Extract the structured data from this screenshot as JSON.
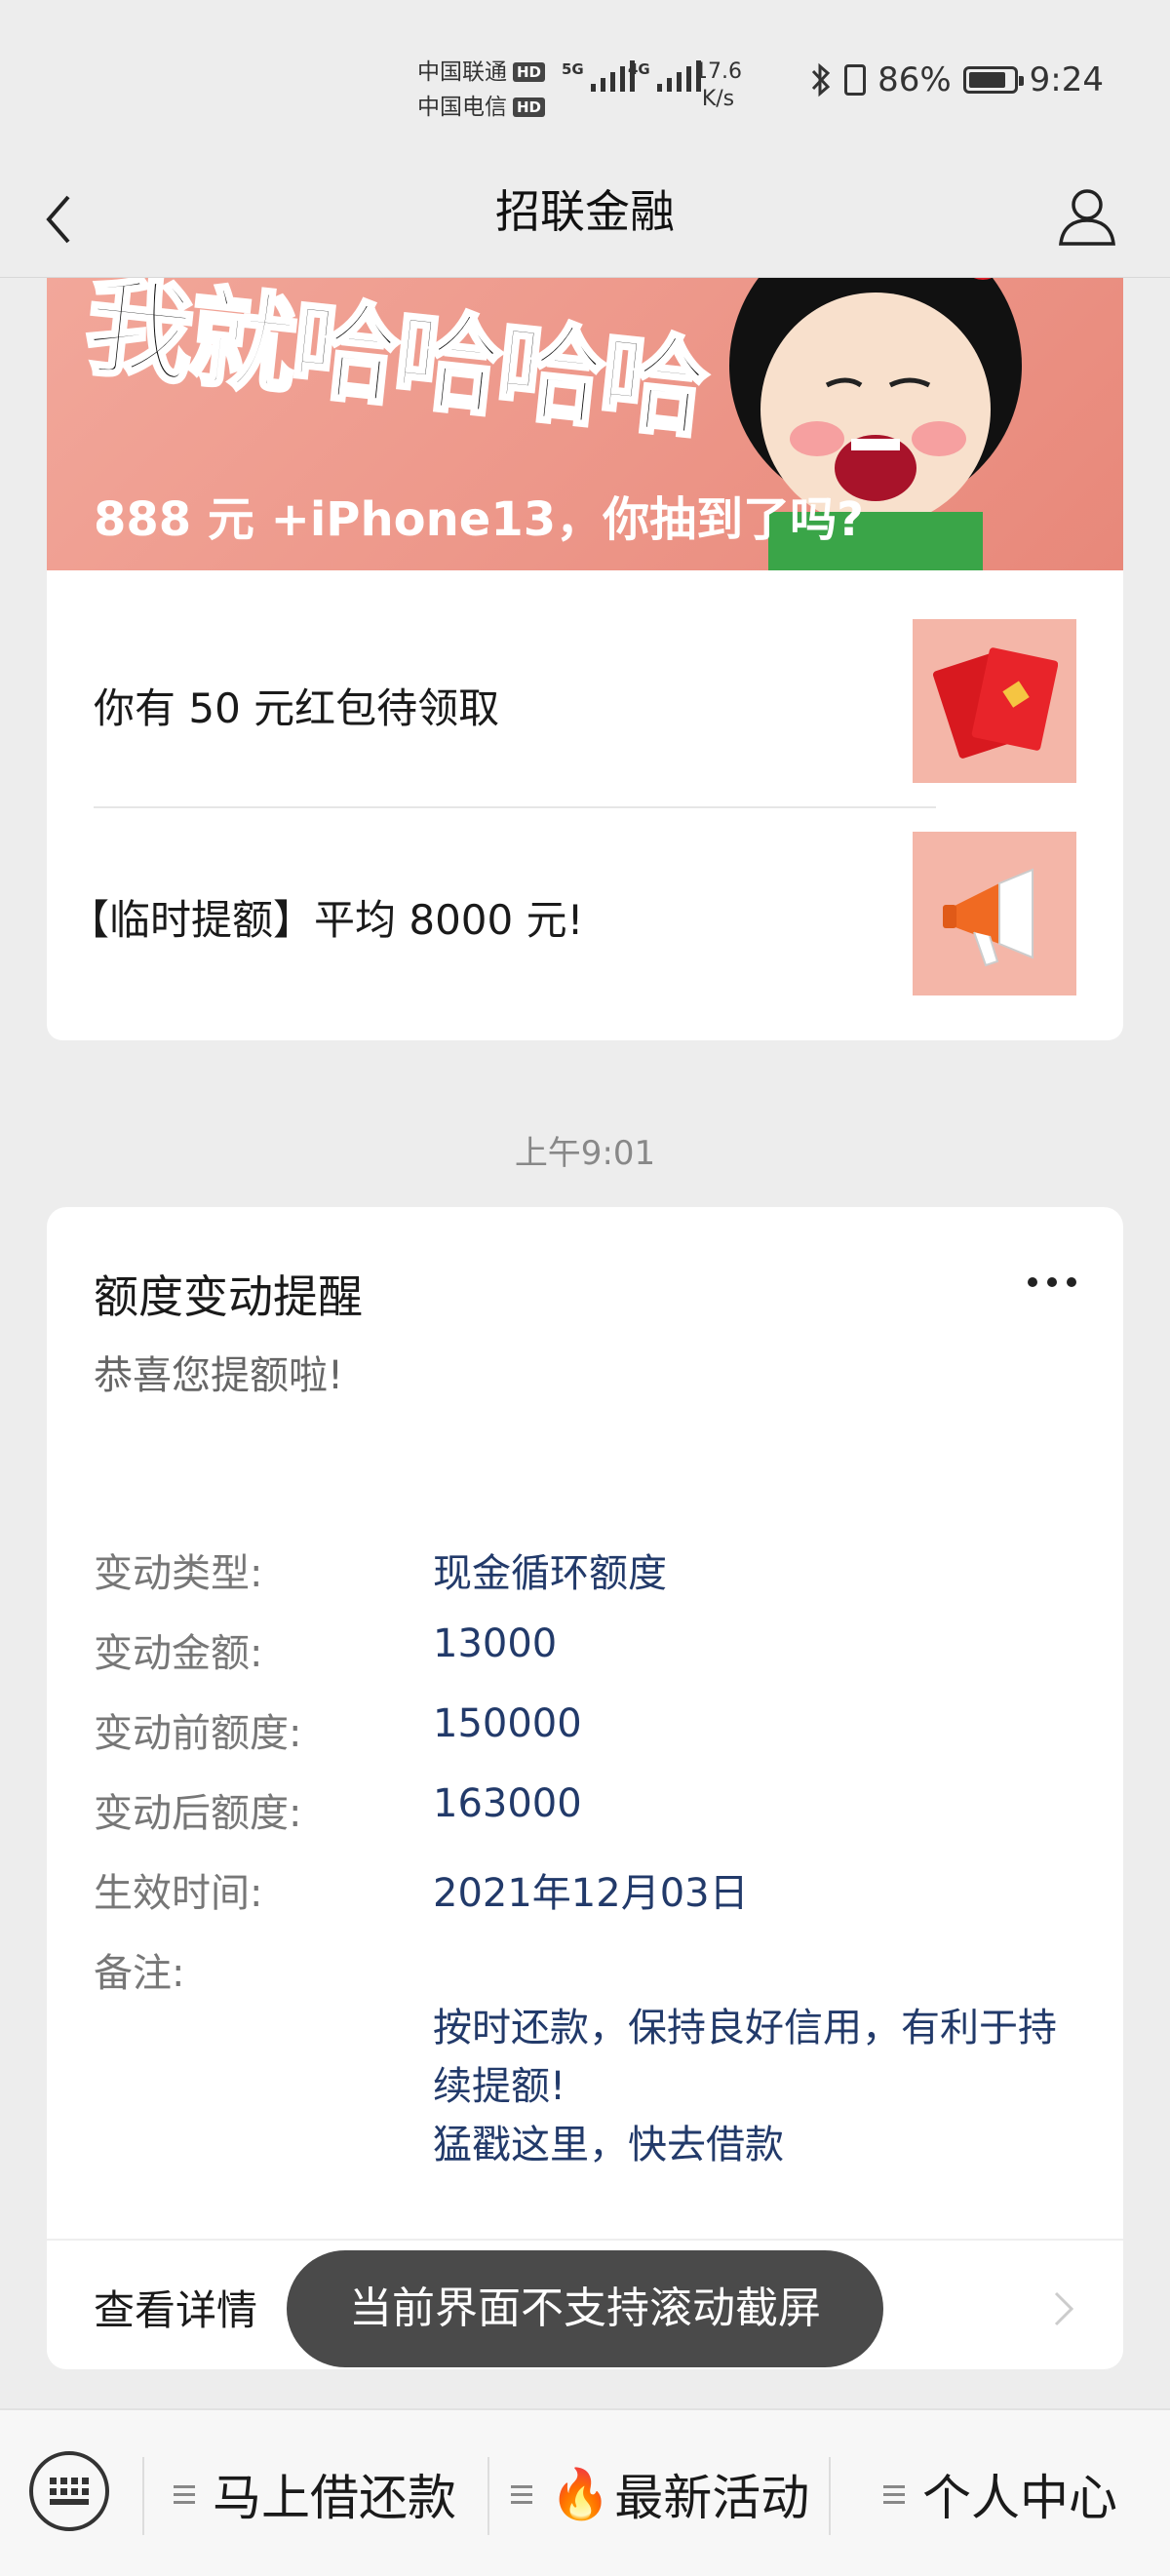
{
  "status_bar": {
    "carrier_1": "中国联通",
    "carrier_2": "中国电信",
    "hd_label": "HD",
    "net_1": "5G",
    "net_2": "4G",
    "speed_value": "17.6",
    "speed_unit": "K/s",
    "battery": "86%",
    "battery_level": 0.86,
    "time": "9:24"
  },
  "header": {
    "title": "招联金融"
  },
  "banner": {
    "big_text": "我就哈哈哈哈",
    "caption": "888 元 +iPhone13，你抽到了吗?"
  },
  "promo_items": [
    {
      "text": "你有 50 元红包待领取",
      "icon": "red-envelope-icon"
    },
    {
      "text": "【临时提额】平均 8000 元!",
      "icon": "megaphone-icon"
    }
  ],
  "timestamp": "上午9:01",
  "notification": {
    "title": "额度变动提醒",
    "subtitle": "恭喜您提额啦!",
    "fields": [
      {
        "label": "变动类型:",
        "value": "现金循环额度"
      },
      {
        "label": "变动金额:",
        "value": "13000"
      },
      {
        "label": "变动前额度:",
        "value": "150000"
      },
      {
        "label": "变动后额度:",
        "value": "163000"
      },
      {
        "label": "生效时间:",
        "value": "2021年12月03日"
      },
      {
        "label": "备注:",
        "value": ""
      }
    ],
    "note_line1": "按时还款，保持良好信用，有利于持续提额!",
    "note_line2": "猛戳这里，快去借款",
    "detail_label": "查看详情"
  },
  "toast": "当前界面不支持滚动截屏",
  "bottom_menu": {
    "items": [
      {
        "label": "马上借还款"
      },
      {
        "label": "最新活动",
        "prefix": "🔥"
      },
      {
        "label": "个人中心"
      }
    ]
  },
  "colors": {
    "background": "#ededed",
    "value_text": "#223a6a",
    "banner": "#e8887a"
  }
}
